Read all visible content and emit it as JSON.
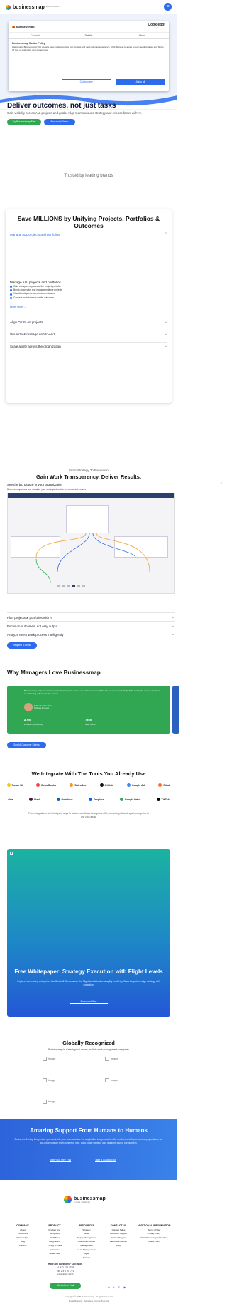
{
  "header": {
    "brand": "businessmap",
    "brand_sub": "by Nave / Kanbanize"
  },
  "cookie": {
    "brand": "businessmap",
    "provider": "Cookiebot",
    "provider_sub": "by Usercentrics",
    "tabs": [
      "Consent",
      "Details",
      "About"
    ],
    "title": "Businessmap Cookie Policy",
    "text": "Welcome to Businessmap! Our website uses cookies to give you the best and most relevant experience. Click Allow all to agree to our Use of Cookies and Terms Of Use or customize your preferences.",
    "customize": "Customize ›",
    "allow_all": "Allow all"
  },
  "hero": {
    "title": "Deliver outcomes, not just tasks",
    "subtitle": "Gain visibility across ALL projects and goals. Align teams around strategy and release faster with AI.",
    "cta1": "Try Businessmap Free",
    "cta2": "Request a Demo"
  },
  "trusted": "Trusted by leading brands",
  "card1": {
    "title": "Save MILLIONS by Unifying Projects, Portfolios & Outcomes",
    "accordion_open": "Manage ALL projects and portfolios",
    "feature_title": "Manage ALL projects and portfolios",
    "features": [
      "Gain transparency across the project portfolio",
      "Break down silos and manage multiple projects",
      "Visualize dependencies between teams",
      "Connect work to measurable outcomes"
    ],
    "learn_more": "Learn more →",
    "accordion": [
      "Align OKRs on projects",
      "Visualize & manage end-to-end",
      "Scale agility across the organization"
    ]
  },
  "strategy": {
    "kicker": "From Strategy To Execution",
    "title": "Gain Work Transparency. Deliver Results.",
    "open": "See the big picture in your organization",
    "open_text": "Businessmap views and visualize your strategic direction on connected boards",
    "items": [
      "Plan projects & portfolios with AI",
      "Focus on outcomes, not only output",
      "Analyze every work process intelligently"
    ],
    "cta": "Request a Demo"
  },
  "managers": {
    "title": "Why Managers Love Businessmap",
    "quote": "Businessmap helps us manage projects and sprints across our entire teams portfolio. We measure productivity KPIs and make quicker decisions on delivering software to the market.",
    "person": "Dzhevdet Kaeshov",
    "role": "Software Engineer",
    "stat1": "47%",
    "stat1_label": "increase in productivity",
    "stat2": "30%",
    "stat2_label": "faster delivery",
    "cta": "See All Customer Stories"
  },
  "integrations": {
    "title": "We Integrate With The Tools You Already Use",
    "row1": [
      "Power Bi",
      "Zoho Books",
      "SalesBox",
      "GitHub",
      "Google Ad",
      "Gitlab"
    ],
    "row2": [
      "okta",
      "Slack",
      "OneDrive",
      "Dropbox",
      "Google Drive",
      "TikTok"
    ],
    "text": "From integrations with third-party apps to custom workflows through our API, connecting all work systems together is one click away!"
  },
  "whitepaper": {
    "title": "Free Whitepaper: Strategy Execution with Flight Levels",
    "text": "Explore how leading enterprises like Bosch & Siemens use the Flight Levels business agility model by Klaus Leopold to align strategy with execution.",
    "cta": "Download Now"
  },
  "global": {
    "title": "Globally Recognized",
    "subtitle": "Businessmap is a leading tool across multiple work management categories",
    "image_label": "image"
  },
  "support": {
    "title": "Amazing Support From Humans to Humans",
    "text": "During the 14-day free period, you can invite your team and see the application in a production-like environment. If you have any questions, our top-notch support team is here to help. Easy to get started. Take a guided tour of our platform.",
    "cta1": "Start Your Free Trial",
    "cta2": "Take a Guided Tour"
  },
  "footer": {
    "brand": "businessmap",
    "brand_sub": "by Nave / Kanbanize",
    "cols": [
      {
        "title": "COMPANY",
        "items": [
          "About",
          "Customers",
          "Partnerships",
          "Blog",
          "Careers"
        ]
      },
      {
        "title": "PRODUCT",
        "items": [
          "Product Tour",
          "Templates",
          "OKR Tool",
          "Integrations",
          "Pricing & Plans",
          "Enterprise",
          "Whats New"
        ]
      },
      {
        "title": "RESOURCES",
        "items": [
          "Strategy",
          "Goals",
          "Project Management",
          "Business Process Management",
          "Lean Management",
          "Agile",
          "Kanban"
        ]
      },
      {
        "title": "CONTACT US",
        "items": [
          "Contact Sales",
          "Customer Support",
          "Partner Program",
          "Become a Partner",
          "FAQ"
        ]
      },
      {
        "title": "ADDITIONAL INFORMATION",
        "items": [
          "Terms of Use",
          "Privacy Policy",
          "Data Processing Addendum",
          "Cookie Policy"
        ]
      }
    ],
    "questions": "Have any questions? Call us on",
    "phones": [
      "+1 517 717 7788",
      "+49 2 9 0 977773",
      "+359 8987 5533"
    ],
    "cta": "Start a Free Trial",
    "copyright": "Copyright © 2025 Businessmap. All rights reserved.",
    "made": "Made Bulgaria, Belvedere Vienna Bulgaria"
  },
  "colors": {
    "blue": "#2c6bed",
    "green": "#31a753",
    "dark": "#0f1432"
  }
}
